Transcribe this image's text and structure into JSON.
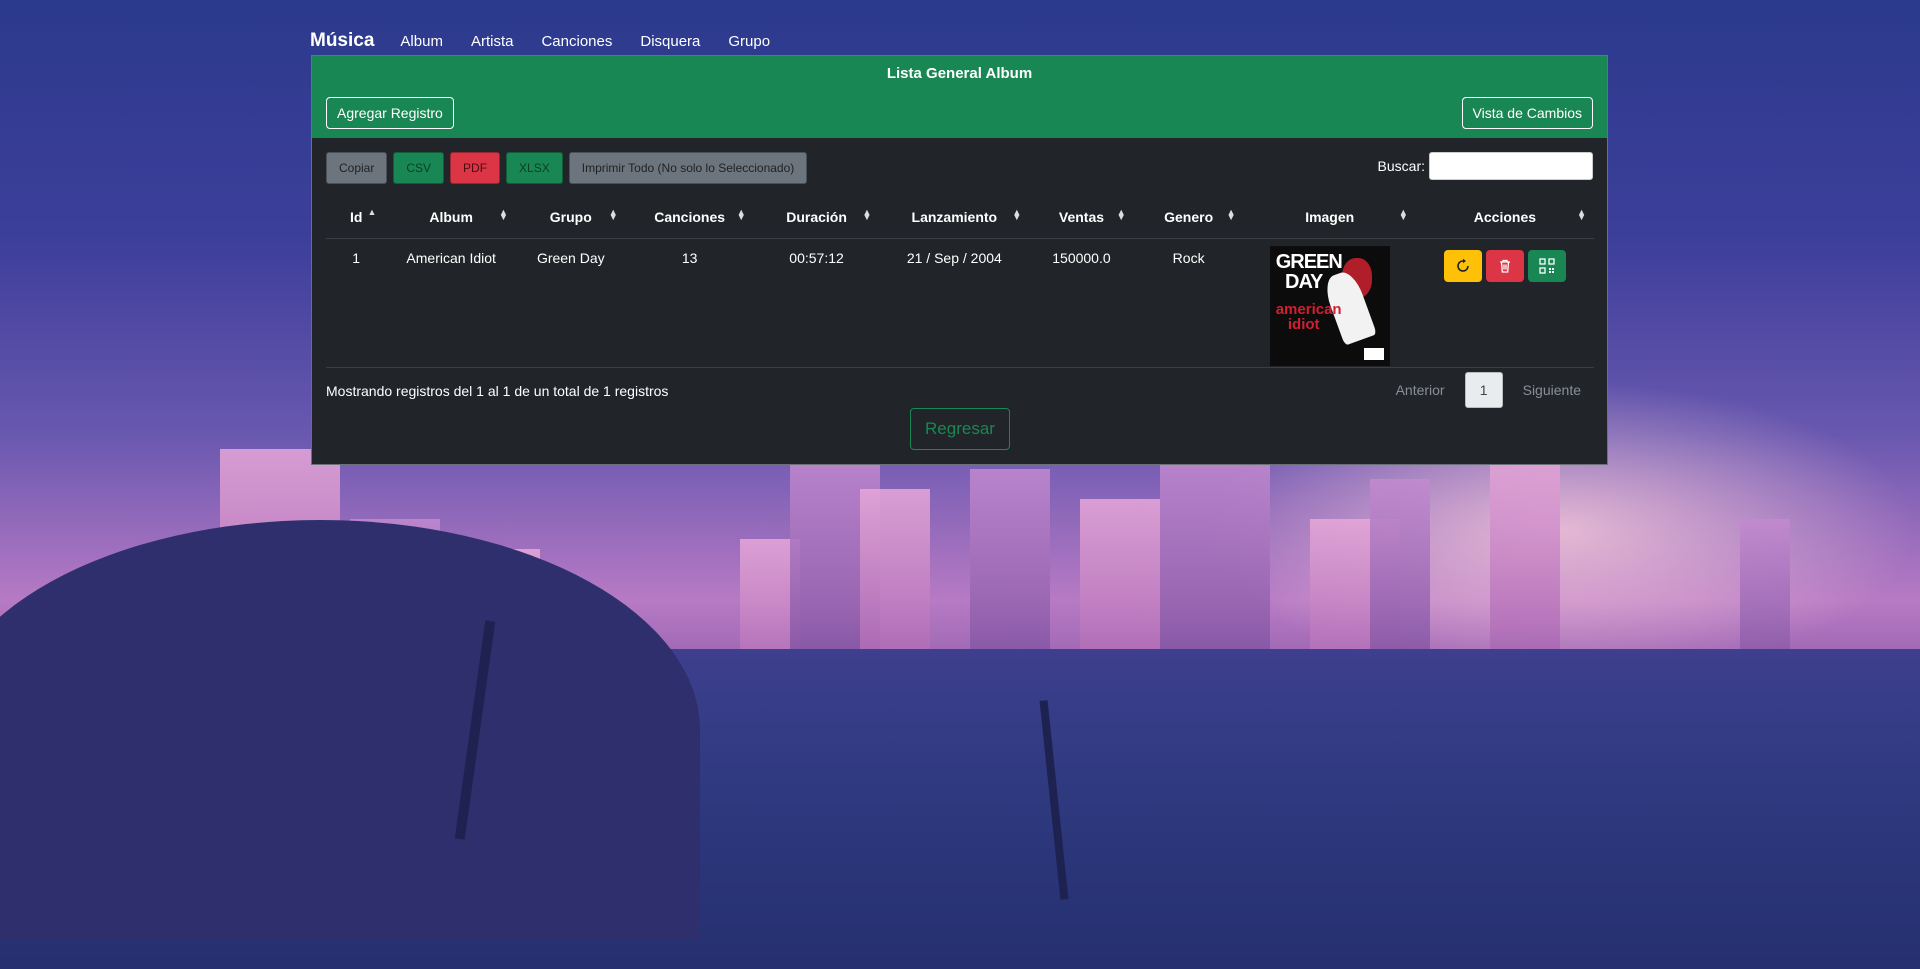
{
  "nav": {
    "brand": "Música",
    "links": [
      "Album",
      "Artista",
      "Canciones",
      "Disquera",
      "Grupo"
    ]
  },
  "panel": {
    "title": "Lista General Album",
    "add_label": "Agregar Registro",
    "changes_label": "Vista de Cambios"
  },
  "toolbar": {
    "copy": "Copiar",
    "csv": "CSV",
    "pdf": "PDF",
    "xlsx": "XLSX",
    "print": "Imprimir Todo (No solo lo Seleccionado)"
  },
  "search": {
    "label": "Buscar:",
    "value": ""
  },
  "table": {
    "headers": [
      "Id",
      "Album",
      "Grupo",
      "Canciones",
      "Duración",
      "Lanzamiento",
      "Ventas",
      "Genero",
      "Imagen",
      "Acciones"
    ],
    "rows": [
      {
        "id": "1",
        "album": "American Idiot",
        "grupo": "Green Day",
        "canciones": "13",
        "duracion": "00:57:12",
        "lanzamiento": "21 / Sep / 2004",
        "ventas": "150000.0",
        "genero": "Rock",
        "cover_line1": "GREEN DAY",
        "cover_line2": "american idiot"
      }
    ]
  },
  "footer": {
    "info": "Mostrando registros del 1 al 1 de un total de 1 registros",
    "prev": "Anterior",
    "page": "1",
    "next": "Siguiente",
    "back": "Regresar"
  },
  "colors": {
    "header_green": "#198754",
    "panel_dark": "#212529",
    "warning": "#ffc107",
    "danger": "#dc3545"
  }
}
